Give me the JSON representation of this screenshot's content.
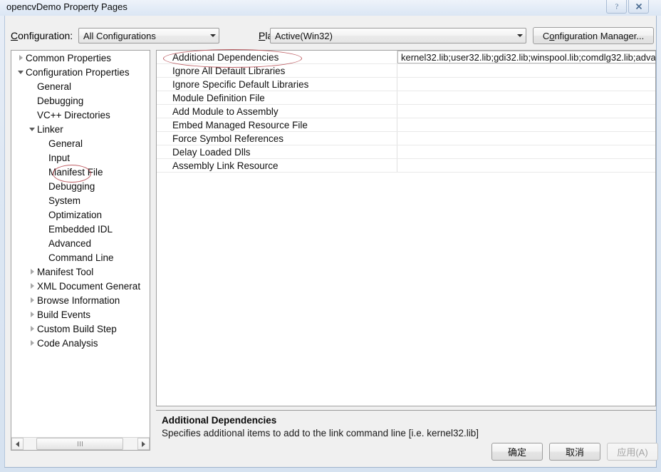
{
  "window": {
    "title": "opencvDemo Property Pages",
    "help_icon": "question-mark-icon",
    "close_icon": "close-icon"
  },
  "config_bar": {
    "configuration_label": "Configuration:",
    "configuration_value": "All Configurations",
    "platform_label": "Platform:",
    "platform_value": "Active(Win32)",
    "configuration_manager_label": "Configuration Manager..."
  },
  "tree": {
    "items": [
      {
        "label": "Common Properties",
        "indent": 0,
        "twisty": "right",
        "selected": false
      },
      {
        "label": "Configuration Properties",
        "indent": 0,
        "twisty": "down",
        "selected": false
      },
      {
        "label": "General",
        "indent": 1,
        "twisty": "none",
        "selected": false
      },
      {
        "label": "Debugging",
        "indent": 1,
        "twisty": "none",
        "selected": false
      },
      {
        "label": "VC++ Directories",
        "indent": 1,
        "twisty": "none",
        "selected": false
      },
      {
        "label": "Linker",
        "indent": 1,
        "twisty": "down",
        "selected": false
      },
      {
        "label": "General",
        "indent": 2,
        "twisty": "none",
        "selected": false
      },
      {
        "label": "Input",
        "indent": 2,
        "twisty": "none",
        "selected": true
      },
      {
        "label": "Manifest File",
        "indent": 2,
        "twisty": "none",
        "selected": false
      },
      {
        "label": "Debugging",
        "indent": 2,
        "twisty": "none",
        "selected": false
      },
      {
        "label": "System",
        "indent": 2,
        "twisty": "none",
        "selected": false
      },
      {
        "label": "Optimization",
        "indent": 2,
        "twisty": "none",
        "selected": false
      },
      {
        "label": "Embedded IDL",
        "indent": 2,
        "twisty": "none",
        "selected": false
      },
      {
        "label": "Advanced",
        "indent": 2,
        "twisty": "none",
        "selected": false
      },
      {
        "label": "Command Line",
        "indent": 2,
        "twisty": "none",
        "selected": false
      },
      {
        "label": "Manifest Tool",
        "indent": 1,
        "twisty": "right",
        "selected": false
      },
      {
        "label": "XML Document Generat",
        "indent": 1,
        "twisty": "right",
        "selected": false
      },
      {
        "label": "Browse Information",
        "indent": 1,
        "twisty": "right",
        "selected": false
      },
      {
        "label": "Build Events",
        "indent": 1,
        "twisty": "right",
        "selected": false
      },
      {
        "label": "Custom Build Step",
        "indent": 1,
        "twisty": "right",
        "selected": false
      },
      {
        "label": "Code Analysis",
        "indent": 1,
        "twisty": "right",
        "selected": false
      }
    ],
    "scrollbar": {
      "left_arrow_icon": "chevron-left-icon",
      "right_arrow_icon": "chevron-right-icon"
    }
  },
  "grid": {
    "rows": [
      {
        "name": "Additional Dependencies",
        "value": "kernel32.lib;user32.lib;gdi32.lib;winspool.lib;comdlg32.lib;adva",
        "selected": true
      },
      {
        "name": "Ignore All Default Libraries",
        "value": "",
        "selected": false
      },
      {
        "name": "Ignore Specific Default Libraries",
        "value": "",
        "selected": false
      },
      {
        "name": "Module Definition File",
        "value": "",
        "selected": false
      },
      {
        "name": "Add Module to Assembly",
        "value": "",
        "selected": false
      },
      {
        "name": "Embed Managed Resource File",
        "value": "",
        "selected": false
      },
      {
        "name": "Force Symbol References",
        "value": "",
        "selected": false
      },
      {
        "name": "Delay Loaded Dlls",
        "value": "",
        "selected": false
      },
      {
        "name": "Assembly Link Resource",
        "value": "",
        "selected": false
      }
    ]
  },
  "description": {
    "title": "Additional Dependencies",
    "body": "Specifies additional items to add to the link command line [i.e. kernel32.lib]"
  },
  "buttons": {
    "ok": "确定",
    "cancel": "取消",
    "apply": "应用(A)"
  },
  "annotations": {
    "color": "#b5484e",
    "targets": [
      "Input",
      "Additional Dependencies"
    ]
  }
}
